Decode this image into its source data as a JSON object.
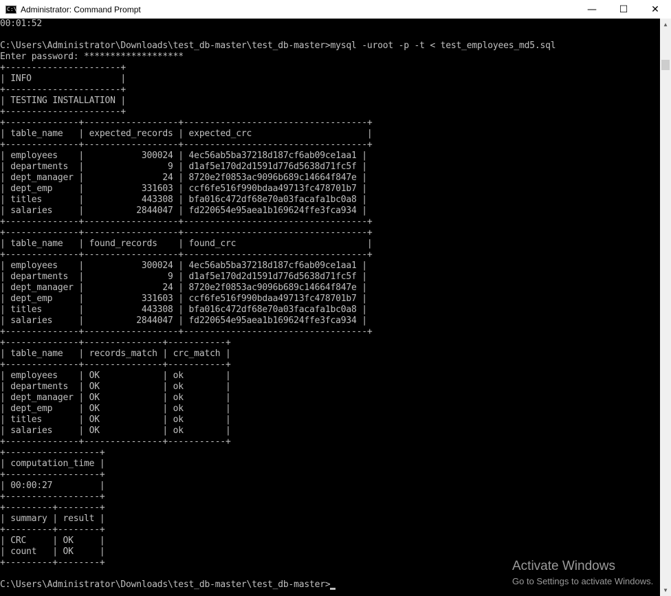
{
  "window": {
    "title": "Administrator: Command Prompt",
    "icon_text": "C:\\",
    "minimize_glyph": "—",
    "maximize_glyph": "☐",
    "close_glyph": "✕"
  },
  "console": {
    "lines": [
      "00:01:52",
      "",
      "C:\\Users\\Administrator\\Downloads\\test_db-master\\test_db-master>mysql -uroot -p -t < test_employees_md5.sql",
      "Enter password: *******************",
      "+----------------------+",
      "| INFO                 |",
      "+----------------------+",
      "| TESTING INSTALLATION |",
      "+----------------------+",
      "+--------------+------------------+-----------------------------------+",
      "| table_name   | expected_records | expected_crc                      |",
      "+--------------+------------------+-----------------------------------+",
      "| employees    |           300024 | 4ec56ab5ba37218d187cf6ab09ce1aa1 |",
      "| departments  |                9 | d1af5e170d2d1591d776d5638d71fc5f |",
      "| dept_manager |               24 | 8720e2f0853ac9096b689c14664f847e |",
      "| dept_emp     |           331603 | ccf6fe516f990bdaa49713fc478701b7 |",
      "| titles       |           443308 | bfa016c472df68e70a03facafa1bc0a8 |",
      "| salaries     |          2844047 | fd220654e95aea1b169624ffe3fca934 |",
      "+--------------+------------------+-----------------------------------+",
      "+--------------+------------------+-----------------------------------+",
      "| table_name   | found_records    | found_crc                         |",
      "+--------------+------------------+-----------------------------------+",
      "| employees    |           300024 | 4ec56ab5ba37218d187cf6ab09ce1aa1 |",
      "| departments  |                9 | d1af5e170d2d1591d776d5638d71fc5f |",
      "| dept_manager |               24 | 8720e2f0853ac9096b689c14664f847e |",
      "| dept_emp     |           331603 | ccf6fe516f990bdaa49713fc478701b7 |",
      "| titles       |           443308 | bfa016c472df68e70a03facafa1bc0a8 |",
      "| salaries     |          2844047 | fd220654e95aea1b169624ffe3fca934 |",
      "+--------------+------------------+-----------------------------------+",
      "+--------------+---------------+-----------+",
      "| table_name   | records_match | crc_match |",
      "+--------------+---------------+-----------+",
      "| employees    | OK            | ok        |",
      "| departments  | OK            | ok        |",
      "| dept_manager | OK            | ok        |",
      "| dept_emp     | OK            | ok        |",
      "| titles       | OK            | ok        |",
      "| salaries     | OK            | ok        |",
      "+--------------+---------------+-----------+",
      "+------------------+",
      "| computation_time |",
      "+------------------+",
      "| 00:00:27         |",
      "+------------------+",
      "+---------+--------+",
      "| summary | result |",
      "+---------+--------+",
      "| CRC     | OK     |",
      "| count   | OK     |",
      "+---------+--------+",
      "",
      "C:\\Users\\Administrator\\Downloads\\test_db-master\\test_db-master>"
    ]
  },
  "scrollbar": {
    "up_glyph": "▲",
    "down_glyph": "▼"
  },
  "watermark": {
    "title": "Activate Windows",
    "subtitle": "Go to Settings to activate Windows."
  }
}
